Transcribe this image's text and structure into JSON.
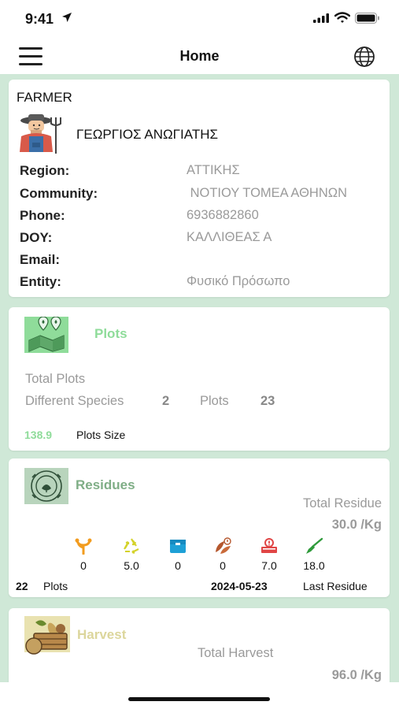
{
  "status": {
    "time": "9:41"
  },
  "header": {
    "title": "Home"
  },
  "farmer": {
    "section_title": "FARMER",
    "name": "ΓΕΩΡΓΙΟΣ ΑΝΩΓΙΑΤΗΣ",
    "fields": [
      {
        "label": "Region:",
        "value": "ΑΤΤΙΚΗΣ"
      },
      {
        "label": "Community:",
        "value": " ΝΟΤΙΟΥ ΤΟΜΕΑ ΑΘΗΝΩΝ"
      },
      {
        "label": "Phone:",
        "value": "6936882860"
      },
      {
        "label": "DOY:",
        "value": "ΚΑΛΛΙΘΕΑΣ Α"
      },
      {
        "label": "Email:",
        "value": ""
      },
      {
        "label": "Entity:",
        "value": "Φυσικό Πρόσωπο"
      }
    ]
  },
  "plots": {
    "title": "Plots",
    "total_label": "Total Plots",
    "species_label": "Different Species",
    "species_value": "2",
    "plots_label": "Plots",
    "plots_value": "23",
    "size_value": "138.9",
    "size_label": "Plots Size",
    "title_color": "#8fdc9a"
  },
  "residues": {
    "title": "Residues",
    "total_label": "Total Residue",
    "total_value": "30.0 /Kg",
    "items": [
      {
        "icon": "branch-icon",
        "value": "0",
        "color": "#f29c1f"
      },
      {
        "icon": "recycle-icon",
        "value": "5.0",
        "color": "#d4d22a"
      },
      {
        "icon": "box-icon",
        "value": "0",
        "color": "#1ea0d6"
      },
      {
        "icon": "leaves-warning-icon",
        "value": "0",
        "color": "#b5572e"
      },
      {
        "icon": "crate-alert-icon",
        "value": "7.0",
        "color": "#e04545"
      },
      {
        "icon": "broom-icon",
        "value": "18.0",
        "color": "#2f9a3b"
      }
    ],
    "plots_value": "22",
    "plots_label": "Plots",
    "last_date": "2024-05-23",
    "last_label": "Last Residue",
    "title_color": "#7fae86"
  },
  "harvest": {
    "title": "Harvest",
    "total_label": "Total Harvest",
    "total_value": "96.0 /Kg",
    "title_color": "#dcd69c"
  }
}
